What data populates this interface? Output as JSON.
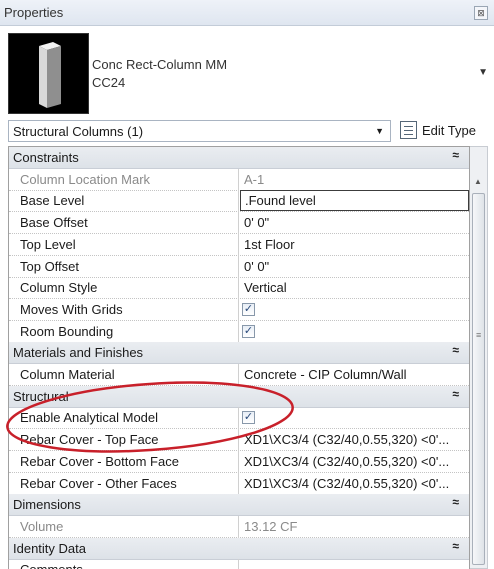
{
  "window": {
    "title": "Properties",
    "close_glyph": "⊠"
  },
  "type_selector": {
    "family": "Conc Rect-Column MM",
    "type_name": "CC24",
    "thumbnail_icon": "column-3d-icon",
    "dropdown_glyph": "▼"
  },
  "filter": {
    "label": "Structural Columns (1)",
    "arrow_glyph": "▼"
  },
  "edit_type": {
    "label": "Edit Type",
    "icon": "edit-type-icon"
  },
  "collapse_glyph": "≈",
  "check_glyph": "✓",
  "sections": [
    {
      "name": "Constraints",
      "props": [
        {
          "name": "Column Location Mark",
          "value": "A-1",
          "readonly": true
        },
        {
          "name": "Base Level",
          "value": ".Found level",
          "active": true
        },
        {
          "name": "Base Offset",
          "value": "0'  0\""
        },
        {
          "name": "Top Level",
          "value": "1st Floor"
        },
        {
          "name": "Top Offset",
          "value": "0'  0\""
        },
        {
          "name": "Column Style",
          "value": "Vertical"
        },
        {
          "name": "Moves With Grids",
          "checked": true
        },
        {
          "name": "Room Bounding",
          "checked": true
        }
      ]
    },
    {
      "name": "Materials and Finishes",
      "props": [
        {
          "name": "Column Material",
          "value": "Concrete - CIP Column/Wall"
        }
      ]
    },
    {
      "name": "Structural",
      "props": [
        {
          "name": "Enable Analytical Model",
          "checked": true
        },
        {
          "name": "Rebar Cover - Top Face",
          "value": "XD1\\XC3/4 (C32/40,0.55,320) <0'..."
        },
        {
          "name": "Rebar Cover - Bottom Face",
          "value": "XD1\\XC3/4 (C32/40,0.55,320) <0'..."
        },
        {
          "name": "Rebar Cover - Other Faces",
          "value": "XD1\\XC3/4 (C32/40,0.55,320) <0'..."
        }
      ]
    },
    {
      "name": "Dimensions",
      "props": [
        {
          "name": "Volume",
          "value": "13.12 CF",
          "readonly": true
        }
      ]
    },
    {
      "name": "Identity Data",
      "props": [
        {
          "name": "Comments",
          "value": ""
        }
      ]
    }
  ],
  "annotation": {
    "shape": "ellipse",
    "color": "#c8202a"
  },
  "colors": {
    "section_bg": "#e3e7ec",
    "border": "#a0a0a0",
    "readonly_text": "#8a8a8a"
  }
}
